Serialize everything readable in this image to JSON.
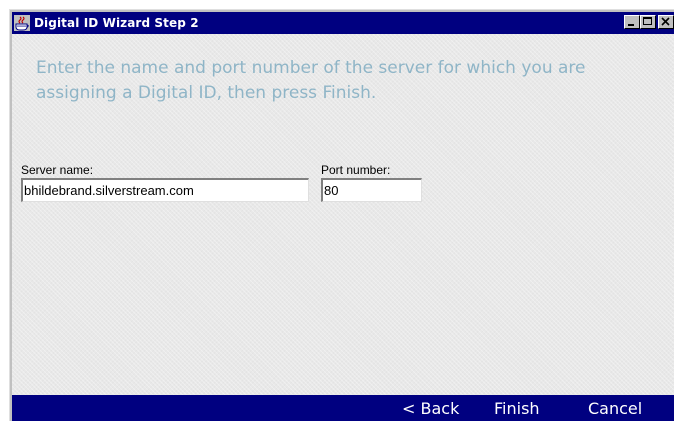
{
  "window": {
    "title": "Digital ID Wizard Step 2"
  },
  "instructions": {
    "text": "Enter the name and port number of the server for which you are assigning a Digital ID, then press Finish."
  },
  "form": {
    "server_name_label": "Server name:",
    "server_name_value": "bhildebrand.silverstream.com",
    "port_number_label": "Port number:",
    "port_number_value": "80"
  },
  "footer": {
    "back_label": "< Back",
    "finish_label": "Finish",
    "cancel_label": "Cancel"
  },
  "icons": {
    "app": "java-cup-icon",
    "minimize": "minimize-icon",
    "maximize": "maximize-icon",
    "close": "close-icon"
  },
  "colors": {
    "titlebar": "#000080",
    "instruction_text": "#8fb5c7",
    "footer": "#000080"
  }
}
